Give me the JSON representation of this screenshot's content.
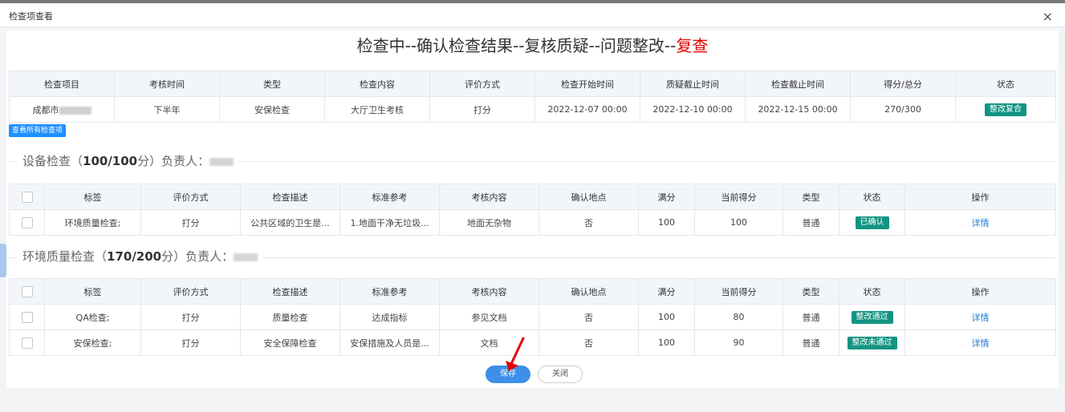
{
  "modal": {
    "title": "检查项查看",
    "close": "×"
  },
  "flow": {
    "part1": "检查中--确认检查结果--复核质疑--问题整改--",
    "part2": "复查"
  },
  "main_table": {
    "headers": [
      "检查项目",
      "考核时间",
      "类型",
      "检查内容",
      "评价方式",
      "检查开始时间",
      "质疑截止时间",
      "检查截止时间",
      "得分/总分",
      "状态"
    ],
    "row": {
      "project": "成都市",
      "time": "下半年",
      "type": "安保检查",
      "content": "大厅卫生考核",
      "method": "打分",
      "start": "2022-12-07 00:00",
      "dispute_end": "2022-12-10 00:00",
      "check_end": "2022-12-15 00:00",
      "score": "270/300",
      "status": "整改复合"
    }
  },
  "view_all_button": "查看所有检查项",
  "section_a": {
    "prefix": "设备检查（",
    "score": "100/100",
    "suffix": "分）负责人："
  },
  "section_b": {
    "prefix": "环境质量检查（",
    "score": "170/200",
    "suffix": "分）负责人："
  },
  "sub_headers": [
    "标签",
    "评价方式",
    "检查描述",
    "标准参考",
    "考核内容",
    "确认地点",
    "满分",
    "当前得分",
    "类型",
    "状态",
    "操作"
  ],
  "table_a_rows": [
    {
      "tag": "环境质量检查;",
      "method": "打分",
      "desc": "公共区域的卫生是...",
      "ref": "1.地面干净无垃圾...",
      "content": "地面无杂物",
      "confirm": "否",
      "full": "100",
      "current": "100",
      "type": "普通",
      "status": "已确认",
      "action": "详情"
    }
  ],
  "table_b_rows": [
    {
      "tag": "QA检查;",
      "method": "打分",
      "desc": "质量检查",
      "ref": "达成指标",
      "content": "参见文档",
      "confirm": "否",
      "full": "100",
      "current": "80",
      "type": "普通",
      "status": "整改通过",
      "action": "详情"
    },
    {
      "tag": "安保检查;",
      "method": "打分",
      "desc": "安全保障检查",
      "ref": "安保措施及人员是...",
      "content": "文档",
      "confirm": "否",
      "full": "100",
      "current": "90",
      "type": "普通",
      "status": "整改未通过",
      "action": "详情"
    }
  ],
  "buttons": {
    "save": "保存",
    "close": "关闭"
  },
  "colors": {
    "badge": "#139483",
    "primary": "#3d8fe8",
    "highlight": "#e60000",
    "arrow": "#e60000"
  }
}
